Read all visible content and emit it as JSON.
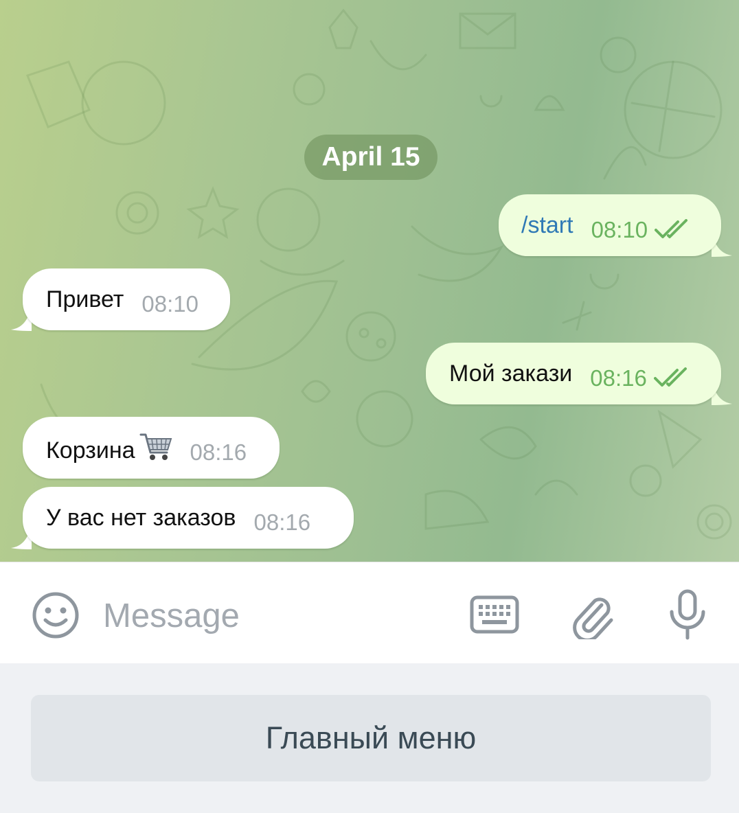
{
  "chat": {
    "date_label": "April 15",
    "messages": [
      {
        "direction": "outgoing",
        "text": "/start",
        "time": "08:10",
        "status": "read"
      },
      {
        "direction": "incoming",
        "text": "Привет",
        "time": "08:10"
      },
      {
        "direction": "outgoing",
        "text": "Мой закази",
        "time": "08:16",
        "status": "read"
      },
      {
        "direction": "incoming",
        "text": "Корзина",
        "emoji": "shopping-cart-icon",
        "time": "08:16"
      },
      {
        "direction": "incoming",
        "text": "У вас нет заказов",
        "time": "08:16"
      }
    ]
  },
  "composer": {
    "placeholder": "Message",
    "left_icon": "emoji-icon",
    "right_icons": [
      "keyboard-icon",
      "attach-icon",
      "microphone-icon"
    ]
  },
  "reply_keyboard": {
    "buttons": [
      {
        "label": "Главный меню"
      }
    ]
  },
  "colors": {
    "outgoing_bubble": "#effedd",
    "incoming_bubble": "#ffffff",
    "outgoing_time": "#6ab35f",
    "command_link": "#2f79b5",
    "date_pill": "#7f9b67"
  }
}
